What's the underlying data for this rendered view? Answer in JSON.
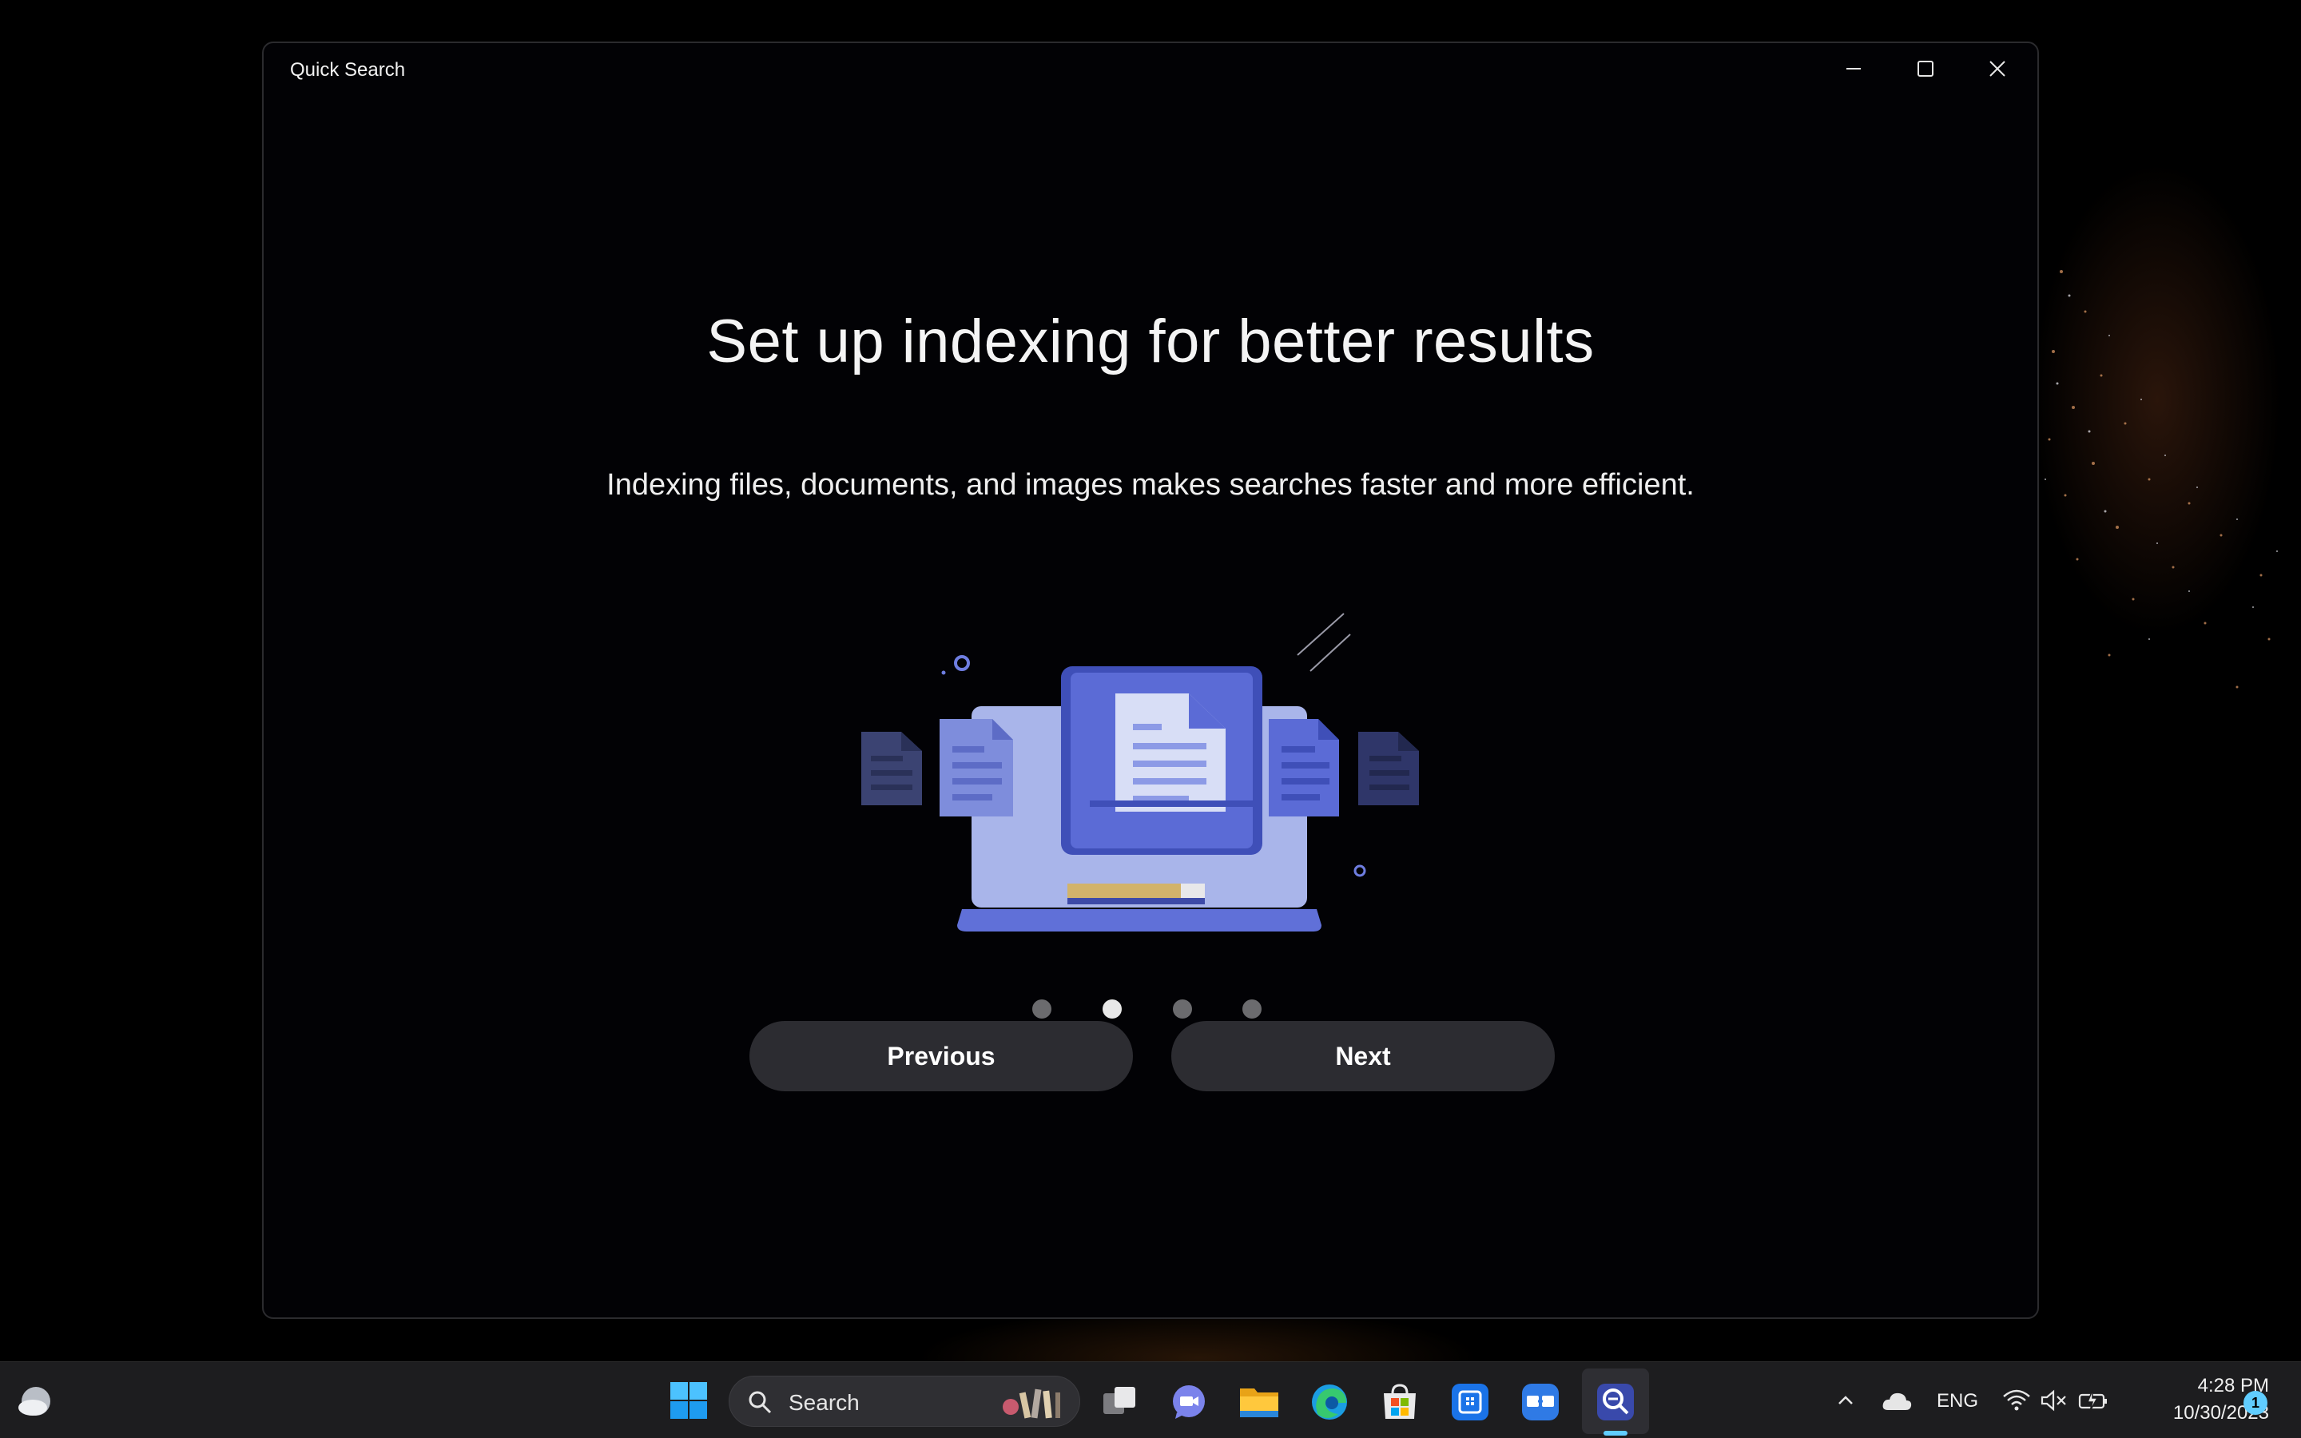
{
  "window": {
    "title": "Quick Search",
    "minimize_icon": "minimize-icon",
    "maximize_icon": "maximize-icon",
    "close_icon": "close-icon"
  },
  "onboarding": {
    "heading": "Set up indexing for better results",
    "subtitle": "Indexing files, documents, and images makes searches faster and more efficient.",
    "illustration_icon": "laptop-documents-illustration",
    "pages_total": 4,
    "current_page": 2,
    "previous_label": "Previous",
    "next_label": "Next"
  },
  "taskbar": {
    "search_placeholder": "Search",
    "apps": [
      "weather-icon",
      "windows-start-icon",
      "task-view-icon",
      "teams-chat-icon",
      "file-explorer-icon",
      "edge-icon",
      "microsoft-store-icon",
      "app-icon",
      "screen-app-icon",
      "quick-search-icon"
    ],
    "tray": {
      "language": "ENG",
      "time": "4:28 PM",
      "date": "10/30/2023",
      "notification_count": "1"
    }
  },
  "colors": {
    "accent": "#60cdff",
    "button_bg": "#2c2c31",
    "illustration_primary": "#5b6bd6",
    "illustration_light": "#aeb9ec"
  }
}
